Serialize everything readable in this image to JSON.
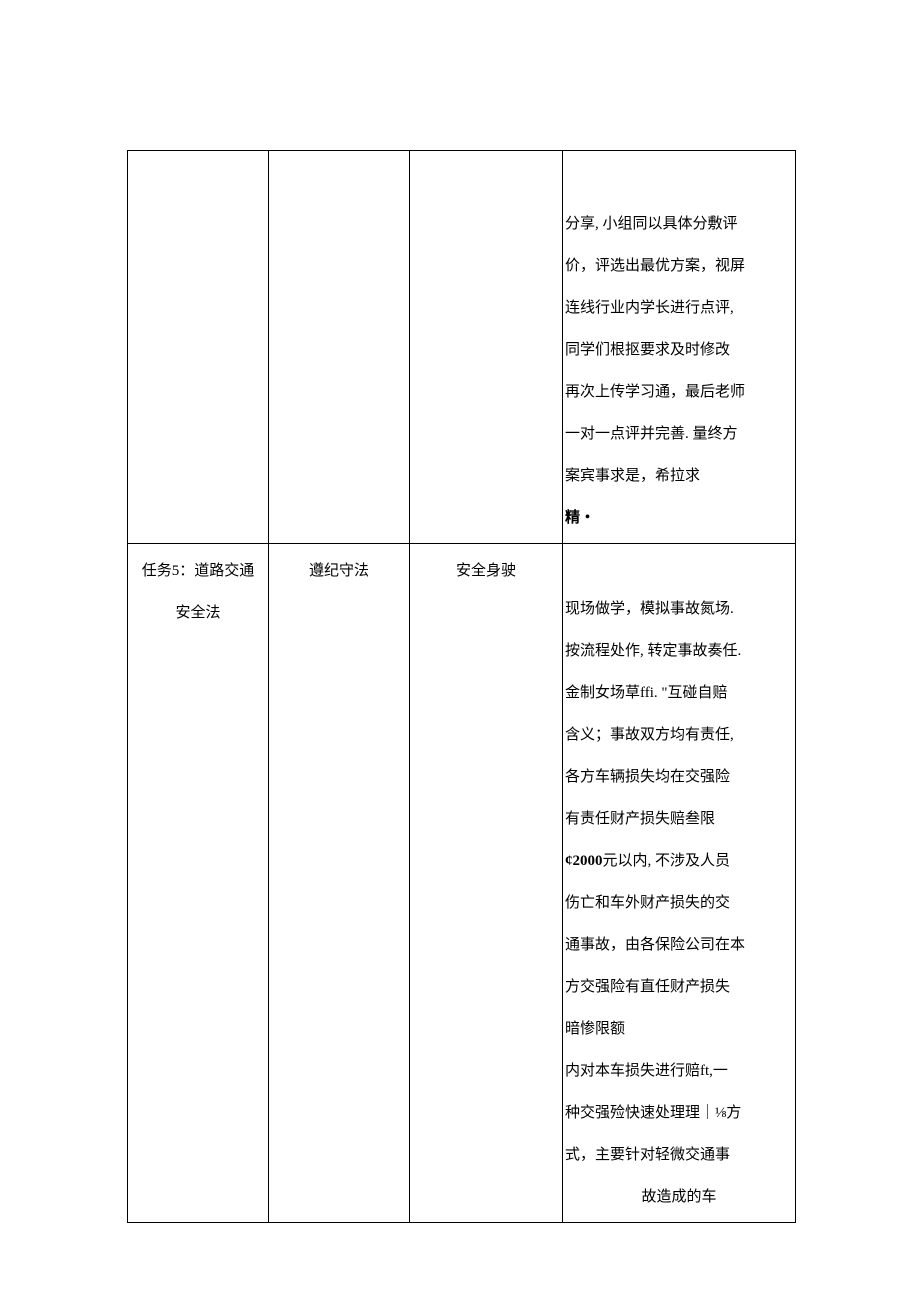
{
  "row1": {
    "col1": "",
    "col2": "",
    "col3": "",
    "col4_lines": [
      "分享, 小组同以具体分敷评",
      "价，评选出最优方案，视屏",
      "连线行业内学长进行点评,",
      "同学们根抠要求及时修改",
      "再次上传学习通，最后老师",
      "一对一点评并完善. 量终方",
      "案宾事求是，希拉求"
    ],
    "col4_last": "精・"
  },
  "row2": {
    "col1_l1": "任务5：道路交通",
    "col1_l2": "安全法",
    "col2": "遵纪守法",
    "col3": "安全身驶",
    "col4_lines": [
      "现场做学，模拟事故氮场.",
      "按流程处作, 转定事故奏任.",
      "金制女场草ffi.   \"互碰自赔",
      "含义；事故双方均有责任,",
      "各方车辆损失均在交强险",
      "有责任财产损失赔叁限"
    ],
    "col4_bold_prefix": "¢2000",
    "col4_bold_suffix": "元以内, 不涉及人员",
    "col4_lines2": [
      "伤亡和车外财产损失的交",
      "通事故，由各保险公司在本",
      "方交强险有直任财产损失",
      "暗惨限额",
      " 内对本车损失进行赔ft,一",
      "种交强殓快速处理理｜⅛方",
      "式，主要针对轻微交通事"
    ],
    "col4_last": "故造成的车"
  }
}
